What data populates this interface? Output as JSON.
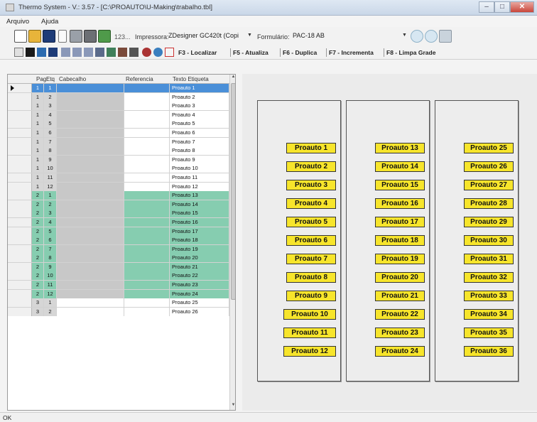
{
  "window": {
    "title": "Thermo System - V.: 3.57 - [C:\\PROAUTO\\U-Making\\trabalho.tbl]"
  },
  "menu": {
    "items": [
      "Arquivo",
      "Ajuda"
    ]
  },
  "toolbar": {
    "printer_label": "Impressora:",
    "printer_value": "ZDesigner GC420t (Copi",
    "form_label": "Formulário:",
    "form_value": "PAC-18 AB",
    "small_label": "123..."
  },
  "function_keys": [
    "F3 - Localizar",
    "F5 - Atualiza",
    "F6 - Duplica",
    "F7 - Incrementa",
    "F8 - Limpa Grade"
  ],
  "grid": {
    "headers": {
      "pag": "Pag",
      "etq": "Etq",
      "cabecalho": "Cabecalho",
      "referencia": "Referencia",
      "texto": "Texto Etiqueta"
    },
    "rows": [
      {
        "pag": "1",
        "etq": "1",
        "texto": "Proauto 1"
      },
      {
        "pag": "1",
        "etq": "2",
        "texto": "Proauto 2"
      },
      {
        "pag": "1",
        "etq": "3",
        "texto": "Proauto 3"
      },
      {
        "pag": "1",
        "etq": "4",
        "texto": "Proauto 4"
      },
      {
        "pag": "1",
        "etq": "5",
        "texto": "Proauto 5"
      },
      {
        "pag": "1",
        "etq": "6",
        "texto": "Proauto 6"
      },
      {
        "pag": "1",
        "etq": "7",
        "texto": "Proauto 7"
      },
      {
        "pag": "1",
        "etq": "8",
        "texto": "Proauto 8"
      },
      {
        "pag": "1",
        "etq": "9",
        "texto": "Proauto 9"
      },
      {
        "pag": "1",
        "etq": "10",
        "texto": "Proauto 10"
      },
      {
        "pag": "1",
        "etq": "11",
        "texto": "Proauto 11"
      },
      {
        "pag": "1",
        "etq": "12",
        "texto": "Proauto 12"
      },
      {
        "pag": "2",
        "etq": "1",
        "texto": "Proauto 13"
      },
      {
        "pag": "2",
        "etq": "2",
        "texto": "Proauto 14"
      },
      {
        "pag": "2",
        "etq": "3",
        "texto": "Proauto 15"
      },
      {
        "pag": "2",
        "etq": "4",
        "texto": "Proauto 16"
      },
      {
        "pag": "2",
        "etq": "5",
        "texto": "Proauto 17"
      },
      {
        "pag": "2",
        "etq": "6",
        "texto": "Proauto 18"
      },
      {
        "pag": "2",
        "etq": "7",
        "texto": "Proauto 19"
      },
      {
        "pag": "2",
        "etq": "8",
        "texto": "Proauto 20"
      },
      {
        "pag": "2",
        "etq": "9",
        "texto": "Proauto 21"
      },
      {
        "pag": "2",
        "etq": "10",
        "texto": "Proauto 22"
      },
      {
        "pag": "2",
        "etq": "11",
        "texto": "Proauto 23"
      },
      {
        "pag": "2",
        "etq": "12",
        "texto": "Proauto 24"
      },
      {
        "pag": "3",
        "etq": "1",
        "texto": "Proauto 25"
      },
      {
        "pag": "3",
        "etq": "2",
        "texto": "Proauto 26"
      }
    ]
  },
  "preview": {
    "columns": [
      [
        "Proauto 1",
        "Proauto 2",
        "Proauto 3",
        "Proauto 4",
        "Proauto 5",
        "Proauto 6",
        "Proauto 7",
        "Proauto 8",
        "Proauto 9",
        "Proauto 10",
        "Proauto 11",
        "Proauto 12"
      ],
      [
        "Proauto 13",
        "Proauto 14",
        "Proauto 15",
        "Proauto 16",
        "Proauto 17",
        "Proauto 18",
        "Proauto 19",
        "Proauto 20",
        "Proauto 21",
        "Proauto 22",
        "Proauto 23",
        "Proauto 24"
      ],
      [
        "Proauto 25",
        "Proauto 26",
        "Proauto 27",
        "Proauto 28",
        "Proauto 29",
        "Proauto 30",
        "Proauto 31",
        "Proauto 32",
        "Proauto 33",
        "Proauto 34",
        "Proauto 35",
        "Proauto 36"
      ]
    ]
  },
  "status": {
    "text": "OK"
  }
}
